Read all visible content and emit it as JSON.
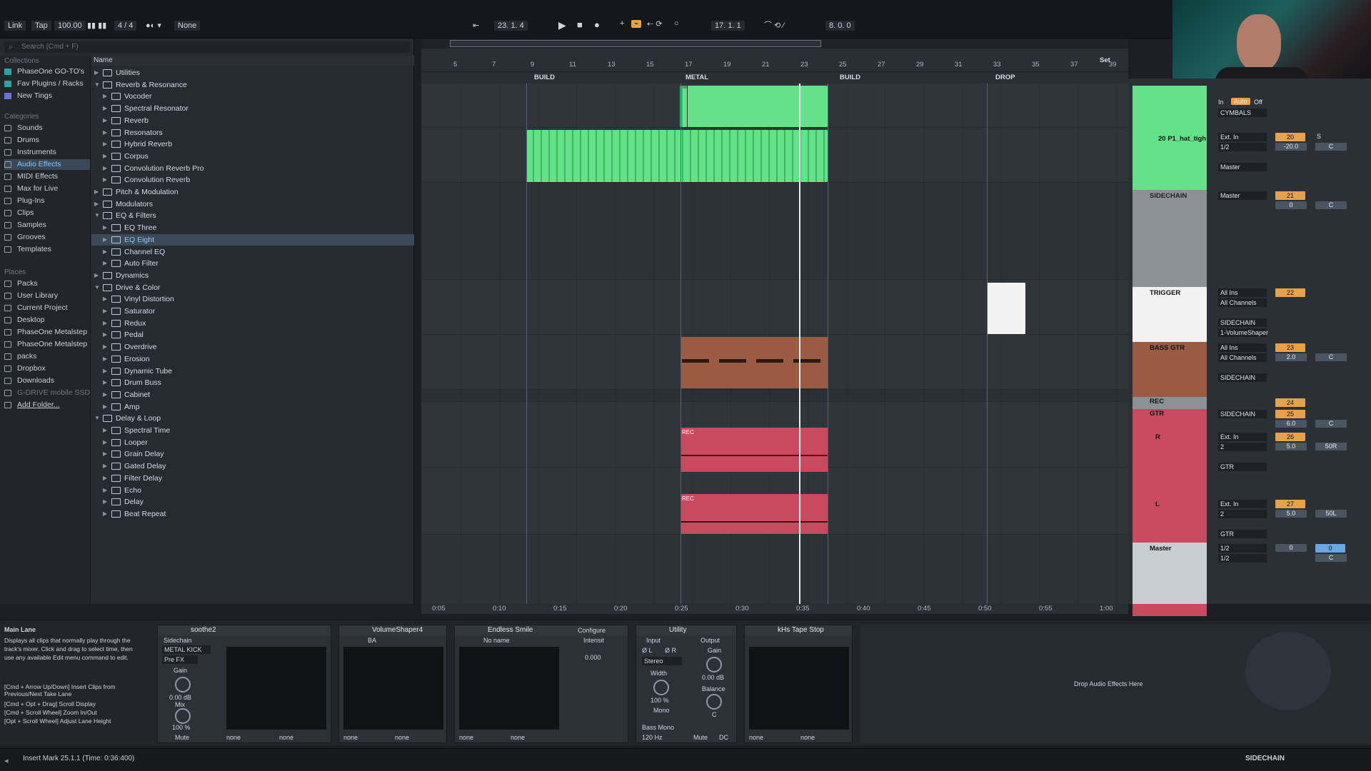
{
  "transport": {
    "link": "Link",
    "tap": "Tap",
    "tempo": "100.00",
    "signature": "4 / 4",
    "quantize": "None",
    "position": "23.  1.  4",
    "loop_start": "17.  1.  1",
    "loop_len": "8.  0.  0"
  },
  "browser": {
    "search_placeholder": "Search (Cmd + F)",
    "collections_title": "Collections",
    "collections": [
      "PhaseOne GO-TO's",
      "Fav Plugins / Racks",
      "New Tings"
    ],
    "categories_title": "Categories",
    "categories": [
      "Sounds",
      "Drums",
      "Instruments",
      "Audio Effects",
      "MIDI Effects",
      "Max for Live",
      "Plug-Ins",
      "Clips",
      "Samples",
      "Grooves",
      "Templates"
    ],
    "places_title": "Places",
    "places": [
      "Packs",
      "User Library",
      "Current Project",
      "Desktop",
      "PhaseOne Metalstep",
      "PhaseOne Metalstep",
      "packs",
      "Dropbox",
      "Downloads",
      "G-DRIVE mobile SSD",
      "Add Folder..."
    ],
    "column_header": "Name",
    "rows": [
      {
        "label": "Utilities",
        "level": 0,
        "open": false
      },
      {
        "label": "Reverb & Resonance",
        "level": 0,
        "open": true
      },
      {
        "label": "Vocoder",
        "level": 1
      },
      {
        "label": "Spectral Resonator",
        "level": 1
      },
      {
        "label": "Reverb",
        "level": 1
      },
      {
        "label": "Resonators",
        "level": 1
      },
      {
        "label": "Hybrid Reverb",
        "level": 1
      },
      {
        "label": "Corpus",
        "level": 1
      },
      {
        "label": "Convolution Reverb Pro",
        "level": 1
      },
      {
        "label": "Convolution Reverb",
        "level": 1
      },
      {
        "label": "Pitch & Modulation",
        "level": 0
      },
      {
        "label": "Modulators",
        "level": 0
      },
      {
        "label": "EQ & Filters",
        "level": 0,
        "open": true
      },
      {
        "label": "EQ Three",
        "level": 1
      },
      {
        "label": "EQ Eight",
        "level": 1,
        "selected": true
      },
      {
        "label": "Channel EQ",
        "level": 1
      },
      {
        "label": "Auto Filter",
        "level": 1
      },
      {
        "label": "Dynamics",
        "level": 0
      },
      {
        "label": "Drive & Color",
        "level": 0,
        "open": true
      },
      {
        "label": "Vinyl Distortion",
        "level": 1
      },
      {
        "label": "Saturator",
        "level": 1
      },
      {
        "label": "Redux",
        "level": 1
      },
      {
        "label": "Pedal",
        "level": 1
      },
      {
        "label": "Overdrive",
        "level": 1
      },
      {
        "label": "Erosion",
        "level": 1
      },
      {
        "label": "Dynamic Tube",
        "level": 1
      },
      {
        "label": "Drum Buss",
        "level": 1
      },
      {
        "label": "Cabinet",
        "level": 1
      },
      {
        "label": "Amp",
        "level": 1
      },
      {
        "label": "Delay & Loop",
        "level": 0,
        "open": true
      },
      {
        "label": "Spectral Time",
        "level": 1
      },
      {
        "label": "Looper",
        "level": 1
      },
      {
        "label": "Grain Delay",
        "level": 1
      },
      {
        "label": "Gated Delay",
        "level": 1
      },
      {
        "label": "Filter Delay",
        "level": 1
      },
      {
        "label": "Echo",
        "level": 1
      },
      {
        "label": "Delay",
        "level": 1
      },
      {
        "label": "Beat Repeat",
        "level": 1
      }
    ]
  },
  "arrangement": {
    "bars": [
      "5",
      "7",
      "9",
      "11",
      "13",
      "15",
      "17",
      "19",
      "21",
      "23",
      "25",
      "27",
      "29",
      "31",
      "33",
      "35",
      "37",
      "39"
    ],
    "locators": [
      "BUILD",
      "METAL",
      "BUILD",
      "DROP"
    ],
    "set_label": "Set",
    "times": [
      "0:05",
      "0:10",
      "0:15",
      "0:20",
      "0:25",
      "0:30",
      "0:35",
      "0:40",
      "0:45",
      "0:50",
      "0:55",
      "1:00"
    ],
    "rec_label": "REC"
  },
  "tracks": [
    {
      "name": "CYMBALS",
      "routing": [
        "In",
        "Auto",
        "Off"
      ],
      "output": "CYMBALS"
    },
    {
      "name": "20 P1_hat_tigh",
      "input": "Ext. In",
      "sub": "1/2",
      "output": "Master",
      "number": "20",
      "volume": "-20.0",
      "pan": "C"
    },
    {
      "name": "SIDECHAIN",
      "output": "Master",
      "number": "21",
      "volume": "0",
      "pan": "C"
    },
    {
      "name": "TRIGGER",
      "input": "All Ins",
      "channel": "All Channels",
      "output": "SIDECHAIN",
      "extra": "1-VolumeShaper",
      "number": "22"
    },
    {
      "name": "BASS GTR",
      "input": "All Ins",
      "channel": "All Channels",
      "output": "SIDECHAIN",
      "number": "23",
      "volume": "2.0",
      "pan": "C"
    },
    {
      "name": "REC",
      "number": "24"
    },
    {
      "name": "GTR",
      "output": "SIDECHAIN",
      "number": "25",
      "volume": "6.0",
      "pan": "C"
    },
    {
      "name": "R",
      "input": "Ext. In",
      "sub": "2",
      "output": "GTR",
      "number": "26",
      "volume": "5.0",
      "pan": "50R"
    },
    {
      "name": "L",
      "input": "Ext. In",
      "sub": "2",
      "output": "GTR",
      "number": "27",
      "volume": "5.0",
      "pan": "50L"
    },
    {
      "name": "Master",
      "input": "1/2",
      "output": "1/2",
      "number": "0",
      "volume": "0",
      "pan": "C"
    }
  ],
  "mixer_labels": {
    "in": "In",
    "auto": "Auto",
    "off": "Off",
    "solo": "S"
  },
  "info": {
    "title": "Main Lane",
    "body": "Displays all clips that normally play through the track's mixer. Click and drag to select time, then use any available Edit menu command to edit.",
    "shortcuts": [
      "[Cmd + Arrow Up/Down] Insert Clips from Previous/Next Take Lane",
      "[Cmd + Opt + Drag] Scroll Display",
      "[Cmd + Scroll Wheel] Zoom In/Out",
      "[Opt + Scroll Wheel] Adjust Lane Height"
    ]
  },
  "devices": [
    {
      "name": "soothe2",
      "sidechain": "Sidechain",
      "source": "METAL KICK",
      "pre": "Pre FX",
      "gain": "Gain",
      "gain_val": "0.00 dB",
      "mix": "Mix",
      "mix_val": "100 %",
      "mute": "Mute",
      "none1": "none",
      "none2": "none"
    },
    {
      "name": "VolumeShaper4",
      "preset": "BA",
      "none1": "none",
      "none2": "none"
    },
    {
      "name": "Endless Smile",
      "configure": "Configure",
      "preset": "No name",
      "intensity": "Intensit",
      "intensity_val": "0.000",
      "none1": "none",
      "none2": "none"
    },
    {
      "name": "Utility",
      "input": "Input",
      "output": "Output",
      "l": "Ø L",
      "r": "Ø R",
      "gain": "Gain",
      "gain_val": "0.00 dB",
      "stereo": "Stereo",
      "width": "Width",
      "width_val": "100 %",
      "balance": "Balance",
      "balance_val": "C",
      "mono": "Mono",
      "bass_mono": "Bass Mono",
      "freq": "120 Hz",
      "mute": "Mute",
      "dc": "DC"
    },
    {
      "name": "kHs Tape Stop",
      "none1": "none",
      "none2": "none"
    }
  ],
  "drop_hint": "Drop Audio Effects Here",
  "status": {
    "message": "Insert Mark 25.1.1 (Time: 0:36:400)",
    "right": "SIDECHAIN"
  },
  "colors": {
    "green": "#63e28a",
    "brown": "#9a5a44",
    "red": "#c94a5e",
    "white": "#f2f2f2",
    "accent": "#e5a24a"
  }
}
